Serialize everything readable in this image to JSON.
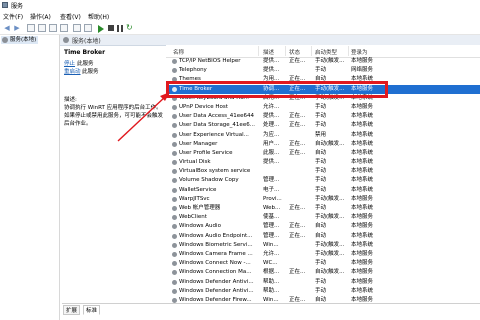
{
  "window": {
    "title": "服务"
  },
  "menu": [
    "文件(F)",
    "操作(A)",
    "查看(V)",
    "帮助(H)"
  ],
  "tree": {
    "node_label": "服务(本地)"
  },
  "header": {
    "label": "服务(本地)"
  },
  "details": {
    "service_title": "Time Broker",
    "stop_link": "停止",
    "stop_rest": "此服务",
    "restart_link": "重启动",
    "restart_rest": "此服务",
    "desc_label": "描述:",
    "desc_text": "协调执行 WinRT 应用程序的后台工作。如果停止或禁用此服务，可可能不会触发后台作业。"
  },
  "columns": [
    "名称",
    "描述",
    "状态",
    "启动类型",
    "登录为"
  ],
  "rows": [
    {
      "name": "TCP/IP NetBIOS Helper",
      "desc": "提供...",
      "status": "正在...",
      "startup": "手动(触发...",
      "logon": "本地服务"
    },
    {
      "name": "Telephony",
      "desc": "提供...",
      "status": "",
      "startup": "手动",
      "logon": "网络服务"
    },
    {
      "name": "Themes",
      "desc": "为用...",
      "status": "正在...",
      "startup": "自动",
      "logon": "本地系统"
    },
    {
      "name": "Time Broker",
      "desc": "协调...",
      "status": "正在...",
      "startup": "手动(触发...",
      "logon": "本地服务"
    },
    {
      "name": "Touch Keyboard and Ha...",
      "desc": "启用...",
      "status": "正在...",
      "startup": "手动(触发...",
      "logon": "本地系统"
    },
    {
      "name": "UPnP Device Host",
      "desc": "允许...",
      "status": "",
      "startup": "手动",
      "logon": "本地服务"
    },
    {
      "name": "User Data Access_41ee644",
      "desc": "提供...",
      "status": "正在...",
      "startup": "手动",
      "logon": "本地系统"
    },
    {
      "name": "User Data Storage_41ee6...",
      "desc": "处理...",
      "status": "正在...",
      "startup": "手动",
      "logon": "本地系统"
    },
    {
      "name": "User Experience Virtual...",
      "desc": "为应...",
      "status": "",
      "startup": "禁用",
      "logon": "本地系统"
    },
    {
      "name": "User Manager",
      "desc": "用户...",
      "status": "正在...",
      "startup": "自动(触发...",
      "logon": "本地系统"
    },
    {
      "name": "User Profile Service",
      "desc": "此服...",
      "status": "正在...",
      "startup": "自动",
      "logon": "本地系统"
    },
    {
      "name": "Virtual Disk",
      "desc": "提供...",
      "status": "",
      "startup": "手动",
      "logon": "本地系统"
    },
    {
      "name": "VirtualBox system service",
      "desc": "",
      "status": "",
      "startup": "手动",
      "logon": "本地系统"
    },
    {
      "name": "Volume Shadow Copy",
      "desc": "管理...",
      "status": "",
      "startup": "手动",
      "logon": "本地系统"
    },
    {
      "name": "WalletService",
      "desc": "电子...",
      "status": "",
      "startup": "手动",
      "logon": "本地系统"
    },
    {
      "name": "WarpJITSvc",
      "desc": "Provi...",
      "status": "",
      "startup": "手动(触发...",
      "logon": "本地服务"
    },
    {
      "name": "Web 帐户管理器",
      "desc": "Web...",
      "status": "正在...",
      "startup": "手动",
      "logon": "本地系统"
    },
    {
      "name": "WebClient",
      "desc": "使基...",
      "status": "",
      "startup": "手动(触发...",
      "logon": "本地服务"
    },
    {
      "name": "Windows Audio",
      "desc": "管理...",
      "status": "正在...",
      "startup": "自动",
      "logon": "本地服务"
    },
    {
      "name": "Windows Audio Endpoint...",
      "desc": "管理...",
      "status": "正在...",
      "startup": "自动",
      "logon": "本地系统"
    },
    {
      "name": "Windows Biometric Servi...",
      "desc": "Win...",
      "status": "",
      "startup": "手动(触发...",
      "logon": "本地系统"
    },
    {
      "name": "Windows Camera Frame ...",
      "desc": "允许...",
      "status": "",
      "startup": "手动(触发...",
      "logon": "本地服务"
    },
    {
      "name": "Windows Connect Now -...",
      "desc": "WC...",
      "status": "",
      "startup": "手动",
      "logon": "本地服务"
    },
    {
      "name": "Windows Connection Ma...",
      "desc": "根据...",
      "status": "正在...",
      "startup": "自动(触发...",
      "logon": "本地服务"
    },
    {
      "name": "Windows Defender Antivi...",
      "desc": "帮助...",
      "status": "",
      "startup": "手动",
      "logon": "本地服务"
    },
    {
      "name": "Windows Defender Antivi...",
      "desc": "帮助...",
      "status": "",
      "startup": "手动",
      "logon": "本地系统"
    },
    {
      "name": "Windows Defender Firew...",
      "desc": "Win...",
      "status": "正在...",
      "startup": "自动",
      "logon": "本地服务"
    }
  ],
  "selected_row": 3,
  "tabs": [
    "扩展",
    "标准"
  ],
  "colors": {
    "selection": "#1f6fd1",
    "highlight": "#e0191f"
  }
}
